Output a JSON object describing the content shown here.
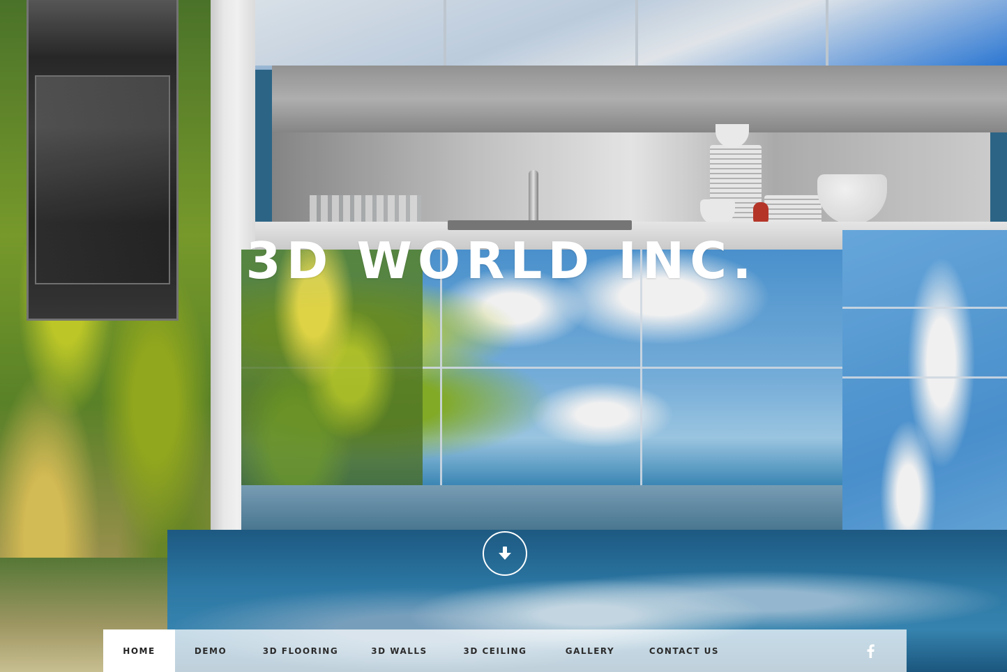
{
  "site": {
    "title": "3D WORLD INC."
  },
  "hero": {
    "scroll_icon": "arrow-down-icon"
  },
  "nav": {
    "items": [
      {
        "label": "HOME",
        "active": true
      },
      {
        "label": "DEMO",
        "active": false
      },
      {
        "label": "3D FLOORING",
        "active": false
      },
      {
        "label": "3D WALLS",
        "active": false
      },
      {
        "label": "3D CEILING",
        "active": false
      },
      {
        "label": "GALLERY",
        "active": false
      },
      {
        "label": "CONTACT US",
        "active": false
      }
    ],
    "social_icon": "facebook-icon"
  },
  "colors": {
    "title_text": "#ffffff",
    "nav_background": "rgba(255,255,255,0.72)",
    "nav_active_background": "#ffffff",
    "nav_text": "#2b2b2b"
  }
}
